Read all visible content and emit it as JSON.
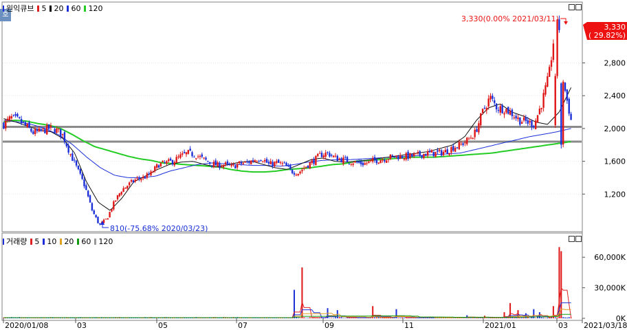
{
  "price_legend": {
    "title": "원익큐브",
    "items": [
      {
        "label": "5",
        "color": "#e02020"
      },
      {
        "label": "20",
        "color": "#000000"
      },
      {
        "label": "60",
        "color": "#1a2fd8"
      },
      {
        "label": "120",
        "color": "#22cc22"
      }
    ]
  },
  "volume_legend": {
    "title": "거래량",
    "items": [
      {
        "label": "5",
        "color": "#e02020"
      },
      {
        "label": "10",
        "color": "#1a2fd8"
      },
      {
        "label": "20",
        "color": "#e0a020"
      },
      {
        "label": "60",
        "color": "#119911"
      },
      {
        "label": "120",
        "color": "#999999"
      }
    ]
  },
  "corner_label": "호",
  "current_price": {
    "value": "3,330",
    "change": "( 29.82%)"
  },
  "annotations": {
    "high": "3,330(0.00% 2021/03/11)",
    "low": "810(-75.68% 2020/03/23)"
  },
  "chart_data": [
    {
      "type": "candlestick",
      "title": "원익큐브",
      "ylim": [
        800,
        3500
      ],
      "yticks": [
        {
          "value": 1200,
          "label": "1,200"
        },
        {
          "value": 1600,
          "label": "1,600"
        },
        {
          "value": 2000,
          "label": "2,000"
        },
        {
          "value": 2400,
          "label": "2,400"
        },
        {
          "value": 2800,
          "label": "2,800"
        }
      ],
      "xticks": [
        {
          "label": "2020/01/08"
        },
        {
          "label": "03"
        },
        {
          "label": "05"
        },
        {
          "label": "07"
        },
        {
          "label": "09"
        },
        {
          "label": "11"
        },
        {
          "label": "2021/01"
        },
        {
          "label": "03"
        },
        {
          "label": "2021/03/18"
        }
      ],
      "horizontal_lines": [
        2020,
        1840
      ],
      "close_anchors": [
        2050,
        2130,
        2100,
        2030,
        1950,
        1960,
        2000,
        1990,
        1920,
        1700,
        1500,
        1300,
        1000,
        820,
        900,
        1100,
        1250,
        1320,
        1380,
        1400,
        1450,
        1560,
        1580,
        1600,
        1660,
        1700,
        1680,
        1630,
        1580,
        1550,
        1560,
        1530,
        1570,
        1580,
        1620,
        1640,
        1560,
        1580,
        1560,
        1480,
        1460,
        1540,
        1600,
        1680,
        1700,
        1640,
        1620,
        1600,
        1580,
        1570,
        1600,
        1620,
        1640,
        1660,
        1660,
        1660,
        1670,
        1690,
        1700,
        1700,
        1720,
        1770,
        1800,
        1860,
        1950,
        2200,
        2380,
        2250,
        2240,
        2180,
        2100,
        2080,
        2050,
        2300,
        2640,
        3330,
        2550,
        2100
      ],
      "ma120": [
        2080,
        2100,
        2090,
        2060,
        2040,
        2000,
        1930,
        1850,
        1780,
        1740,
        1700,
        1660,
        1630,
        1610,
        1580,
        1570,
        1560,
        1550,
        1540,
        1530,
        1500,
        1480,
        1470,
        1470,
        1480,
        1500,
        1510,
        1520,
        1540,
        1560,
        1570,
        1600,
        1610,
        1620,
        1630,
        1640,
        1650,
        1650,
        1650,
        1660,
        1670,
        1680,
        1690,
        1700,
        1720,
        1740,
        1760,
        1780,
        1800,
        1820,
        1840
      ],
      "ma60": [
        2100,
        2080,
        2050,
        2000,
        1920,
        1800,
        1650,
        1520,
        1430,
        1400,
        1400,
        1420,
        1480,
        1520,
        1560,
        1580,
        1570,
        1560,
        1550,
        1550,
        1540,
        1560,
        1590,
        1610,
        1620,
        1620,
        1630,
        1640,
        1650,
        1660,
        1670,
        1680,
        1690,
        1700,
        1740,
        1780,
        1820,
        1860,
        1900,
        1930,
        1960,
        2000
      ],
      "ma20": [
        2120,
        2080,
        2030,
        1980,
        1960,
        1880,
        1700,
        1350,
        1100,
        1000,
        1150,
        1350,
        1420,
        1500,
        1560,
        1590,
        1600,
        1560,
        1530,
        1560,
        1590,
        1600,
        1560,
        1520,
        1500,
        1560,
        1620,
        1640,
        1600,
        1590,
        1600,
        1620,
        1640,
        1660,
        1680,
        1700,
        1720,
        1760,
        1800,
        1900,
        2100,
        2250,
        2300,
        2200,
        2150,
        2080,
        2050,
        2200,
        2500
      ]
    },
    {
      "type": "bar",
      "title": "거래량",
      "ylim": [
        0,
        75000
      ],
      "yticks": [
        {
          "value": 0,
          "label": "0K"
        },
        {
          "value": 30000,
          "label": "30,000K"
        },
        {
          "value": 60000,
          "label": "60,000K"
        }
      ],
      "spikes": [
        {
          "index": 148,
          "value": 28000
        },
        {
          "index": 152,
          "value": 50000
        },
        {
          "index": 165,
          "value": 10000
        },
        {
          "index": 170,
          "value": 8000
        },
        {
          "index": 188,
          "value": 12000
        },
        {
          "index": 200,
          "value": 9000
        },
        {
          "index": 236,
          "value": 3000
        },
        {
          "index": 245,
          "value": 2500
        },
        {
          "index": 255,
          "value": 6000
        },
        {
          "index": 258,
          "value": 15000
        },
        {
          "index": 262,
          "value": 8000
        },
        {
          "index": 266,
          "value": 5000
        },
        {
          "index": 270,
          "value": 9000
        },
        {
          "index": 273,
          "value": 6000
        },
        {
          "index": 280,
          "value": 12000
        },
        {
          "index": 283,
          "value": 70000
        },
        {
          "index": 284,
          "value": 66000
        }
      ]
    }
  ]
}
